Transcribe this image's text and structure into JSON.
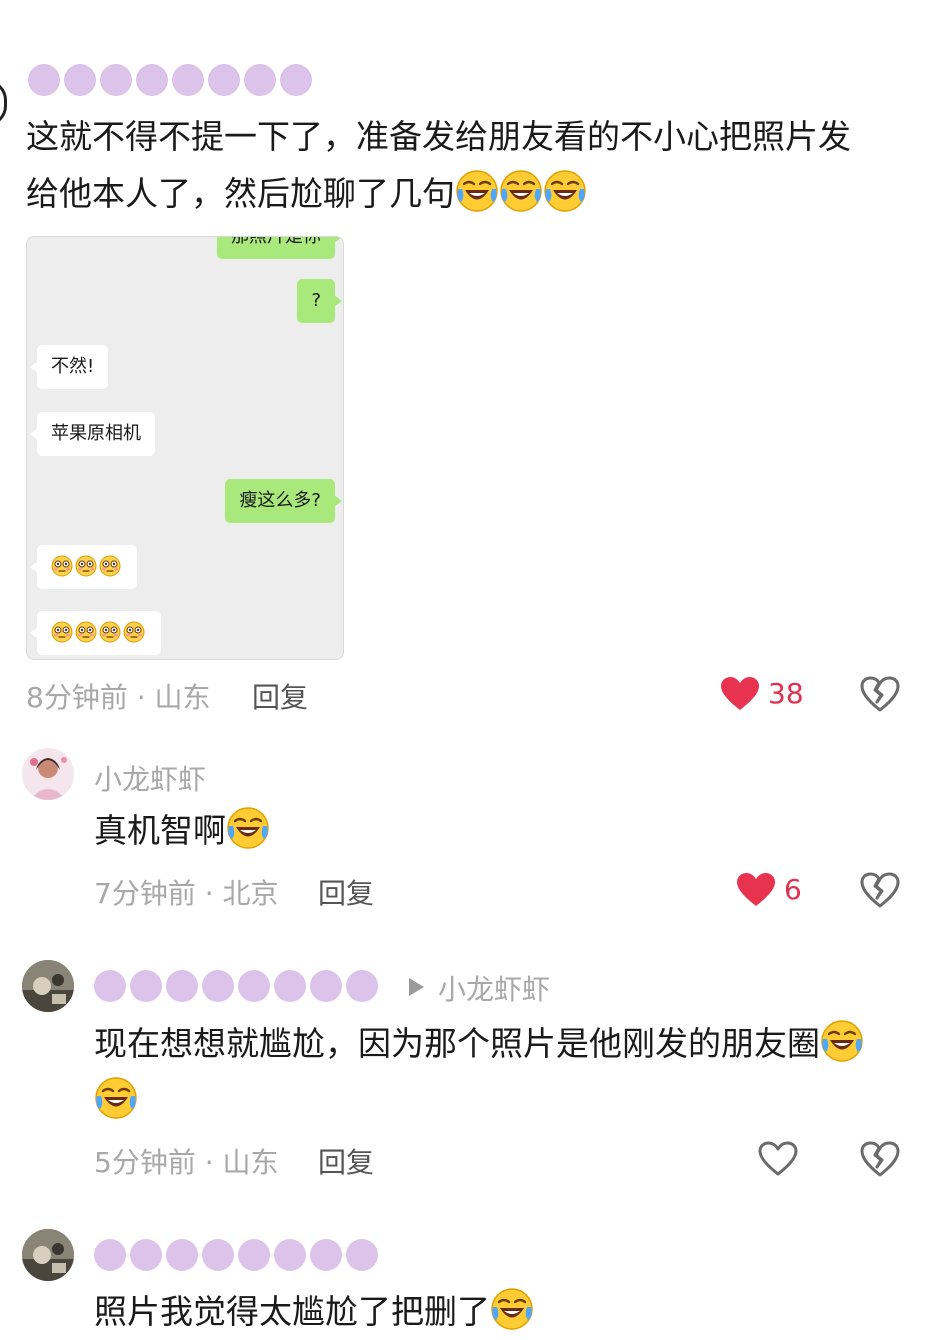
{
  "comment1": {
    "line1": "这就不得不提一下了，准备发给朋友看的不小心把照片发",
    "line2": "给他本人了，然后尬聊了几句",
    "emoji": "laughing-crying-emoji",
    "screenshot": {
      "top_partial": "那照片是你",
      "msg_question": "?",
      "msg_1": "不然!",
      "msg_2": "苹果原相机",
      "msg_3": "瘦这么多?",
      "emoji": "flushed-emoji"
    },
    "time": "8分钟前 · 山东",
    "reply": "回复",
    "likes": "38"
  },
  "reply1": {
    "username": "小龙虾虾",
    "text": "真机智啊",
    "time": "7分钟前 · 北京",
    "reply": "回复",
    "likes": "6"
  },
  "reply2": {
    "reply_to": "小龙虾虾",
    "text_line1": "现在想想就尴尬，因为那个照片是他刚发的朋友圈",
    "time": "5分钟前 · 山东",
    "reply": "回复"
  },
  "reply3": {
    "text": "照片我觉得太尴尬了把删了"
  },
  "colors": {
    "like_red": "#e8334f",
    "hidden_name_purple": "#dcc3ea",
    "wechat_green": "#a9e87a"
  }
}
